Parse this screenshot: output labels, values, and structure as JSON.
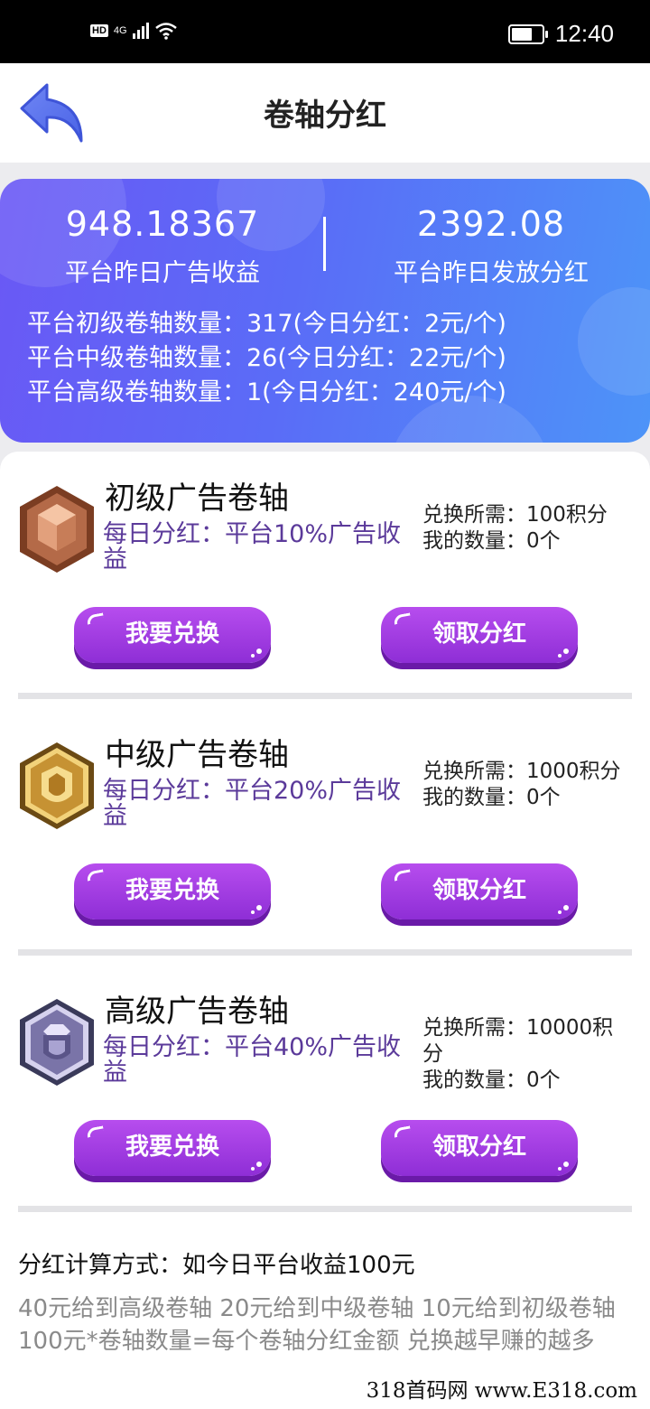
{
  "status_bar": {
    "network": "4G",
    "hd": "HD",
    "time": "12:40"
  },
  "header": {
    "title": "卷轴分红"
  },
  "banner": {
    "left_value": "948.18367",
    "left_label": "平台昨日广告收益",
    "right_value": "2392.08",
    "right_label": "平台昨日发放分红",
    "lines": [
      "平台初级卷轴数量：317(今日分红：2元/个)",
      "平台中级卷轴数量：26(今日分红：22元/个)",
      "平台高级卷轴数量：1(今日分红：240元/个)"
    ]
  },
  "tiers": [
    {
      "name": "初级广告卷轴",
      "desc": "每日分红：平台10%广告收益",
      "cost": "兑换所需：100积分",
      "owned": "我的数量：0个",
      "exchange_label": "我要兑换",
      "claim_label": "领取分红",
      "badge_icon": "bronze-badge-icon"
    },
    {
      "name": "中级广告卷轴",
      "desc": "每日分红：平台20%广告收益",
      "cost": "兑换所需：1000积分",
      "owned": "我的数量：0个",
      "exchange_label": "我要兑换",
      "claim_label": "领取分红",
      "badge_icon": "gold-badge-icon"
    },
    {
      "name": "高级广告卷轴",
      "desc": "每日分红：平台40%广告收益",
      "cost": "兑换所需：10000积分",
      "owned": "我的数量：0个",
      "exchange_label": "我要兑换",
      "claim_label": "领取分红",
      "badge_icon": "diamond-badge-icon"
    }
  ],
  "formula": {
    "title": "分红计算方式：如今日平台收益100元",
    "body": "40元给到高级卷轴 20元给到中级卷轴 10元给到初级卷轴 100元*卷轴数量=每个卷轴分红金额 兑换越早赚的越多"
  },
  "watermark": "318首码网 www.E318.com",
  "colors": {
    "banner_start": "#6a58f5",
    "banner_end": "#4d94f8",
    "button": "#9a36dd",
    "desc_text": "#5b3a9a"
  }
}
